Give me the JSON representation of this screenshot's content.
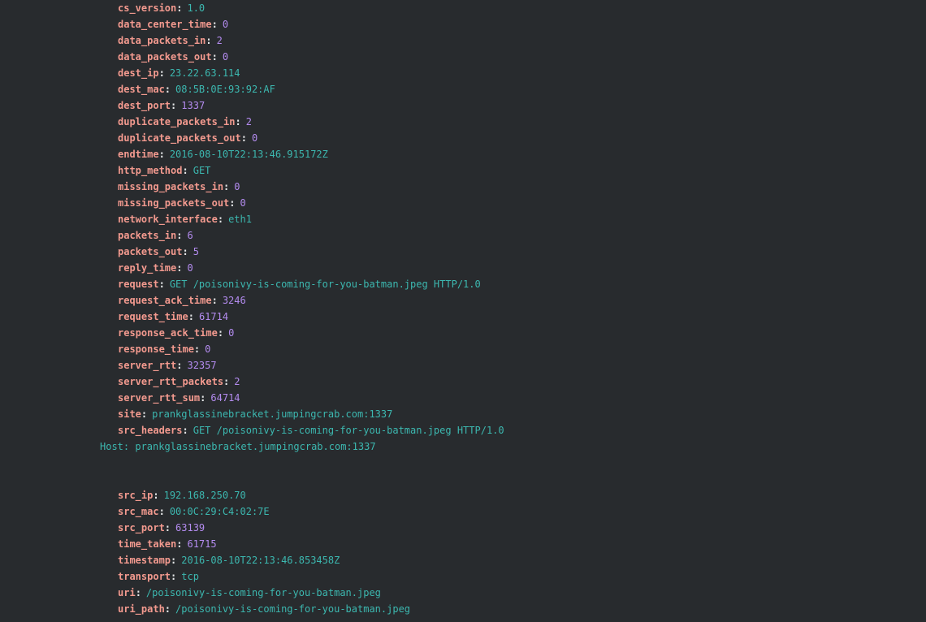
{
  "fields_top": [
    {
      "key": "cs_version",
      "value": "1.0",
      "kind": "str"
    },
    {
      "key": "data_center_time",
      "value": "0",
      "kind": "num"
    },
    {
      "key": "data_packets_in",
      "value": "2",
      "kind": "num"
    },
    {
      "key": "data_packets_out",
      "value": "0",
      "kind": "num"
    },
    {
      "key": "dest_ip",
      "value": "23.22.63.114",
      "kind": "str"
    },
    {
      "key": "dest_mac",
      "value": "08:5B:0E:93:92:AF",
      "kind": "str"
    },
    {
      "key": "dest_port",
      "value": "1337",
      "kind": "num"
    },
    {
      "key": "duplicate_packets_in",
      "value": "2",
      "kind": "num"
    },
    {
      "key": "duplicate_packets_out",
      "value": "0",
      "kind": "num"
    },
    {
      "key": "endtime",
      "value": "2016-08-10T22:13:46.915172Z",
      "kind": "str"
    },
    {
      "key": "http_method",
      "value": "GET",
      "kind": "str"
    },
    {
      "key": "missing_packets_in",
      "value": "0",
      "kind": "num"
    },
    {
      "key": "missing_packets_out",
      "value": "0",
      "kind": "num"
    },
    {
      "key": "network_interface",
      "value": "eth1",
      "kind": "str"
    },
    {
      "key": "packets_in",
      "value": "6",
      "kind": "num"
    },
    {
      "key": "packets_out",
      "value": "5",
      "kind": "num"
    },
    {
      "key": "reply_time",
      "value": "0",
      "kind": "num"
    },
    {
      "key": "request",
      "value": "GET /poisonivy-is-coming-for-you-batman.jpeg HTTP/1.0",
      "kind": "str"
    },
    {
      "key": "request_ack_time",
      "value": "3246",
      "kind": "num"
    },
    {
      "key": "request_time",
      "value": "61714",
      "kind": "num"
    },
    {
      "key": "response_ack_time",
      "value": "0",
      "kind": "num"
    },
    {
      "key": "response_time",
      "value": "0",
      "kind": "num"
    },
    {
      "key": "server_rtt",
      "value": "32357",
      "kind": "num"
    },
    {
      "key": "server_rtt_packets",
      "value": "2",
      "kind": "num"
    },
    {
      "key": "server_rtt_sum",
      "value": "64714",
      "kind": "num"
    },
    {
      "key": "site",
      "value": "prankglassinebracket.jumpingcrab.com:1337",
      "kind": "str"
    },
    {
      "key": "src_headers",
      "value": "GET /poisonivy-is-coming-for-you-batman.jpeg HTTP/1.0",
      "kind": "str"
    }
  ],
  "src_headers_continuation": "Host: prankglassinebracket.jumpingcrab.com:1337",
  "fields_bottom": [
    {
      "key": "src_ip",
      "value": "192.168.250.70",
      "kind": "str"
    },
    {
      "key": "src_mac",
      "value": "00:0C:29:C4:02:7E",
      "kind": "str"
    },
    {
      "key": "src_port",
      "value": "63139",
      "kind": "num"
    },
    {
      "key": "time_taken",
      "value": "61715",
      "kind": "num"
    },
    {
      "key": "timestamp",
      "value": "2016-08-10T22:13:46.853458Z",
      "kind": "str"
    },
    {
      "key": "transport",
      "value": "tcp",
      "kind": "str"
    },
    {
      "key": "uri",
      "value": "/poisonivy-is-coming-for-you-batman.jpeg",
      "kind": "str"
    },
    {
      "key": "uri_path",
      "value": "/poisonivy-is-coming-for-you-batman.jpeg",
      "kind": "str"
    }
  ],
  "colors": {
    "background": "#282b2e",
    "key": "#f39a8f",
    "string_value": "#3cb8b0",
    "number_value": "#b48cf0"
  }
}
